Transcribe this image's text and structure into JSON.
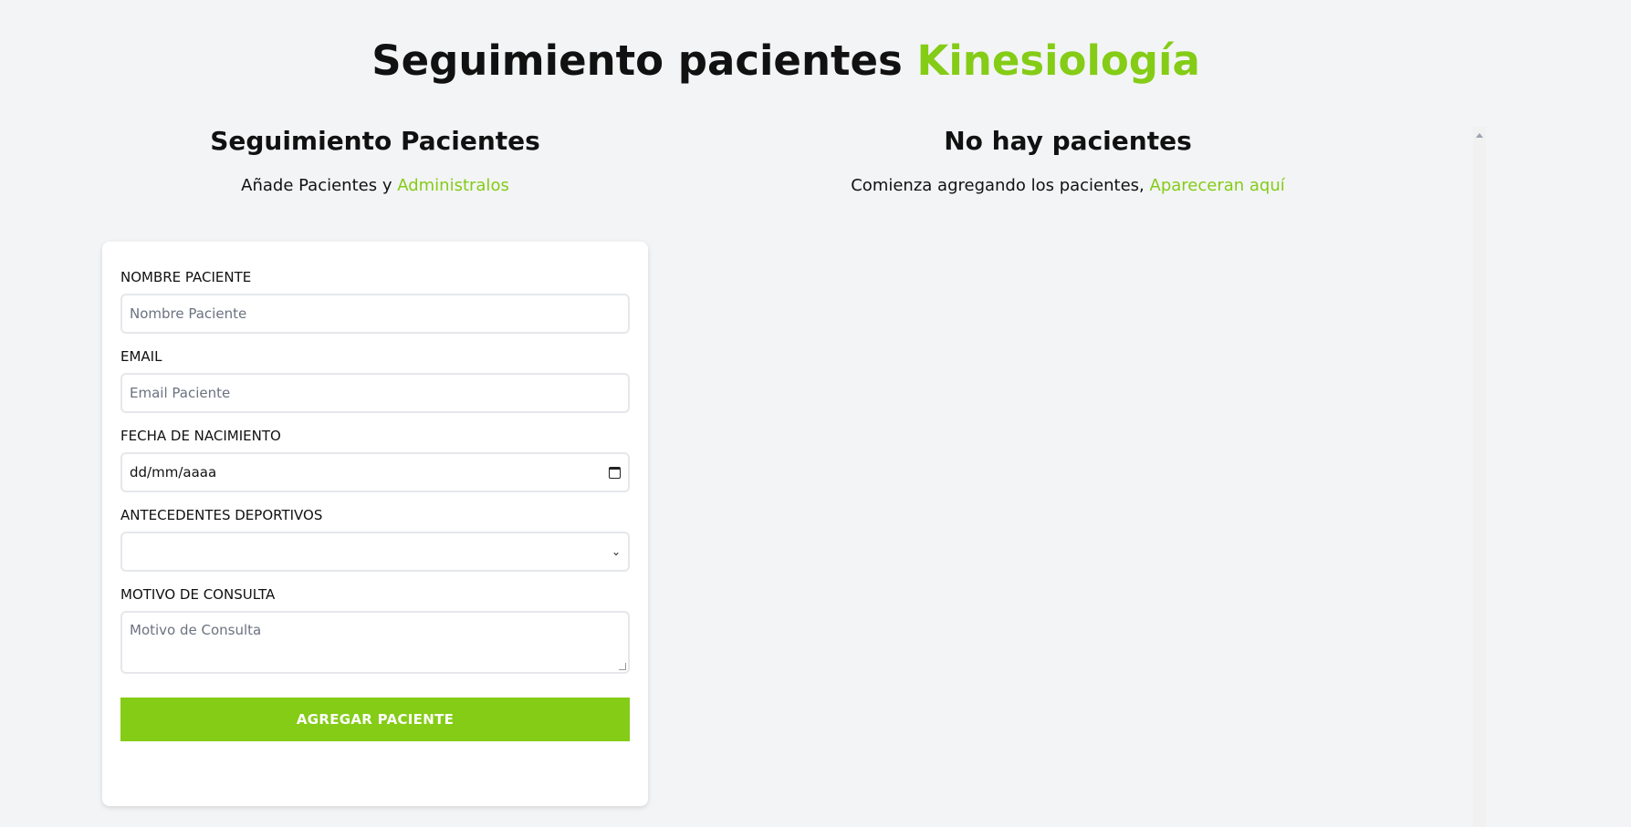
{
  "header": {
    "title_main": "Seguimiento pacientes ",
    "title_accent": "Kinesiología"
  },
  "form_section": {
    "title": "Seguimiento Pacientes",
    "subtitle_prefix": "Añade Pacientes y ",
    "subtitle_link": "Administralos"
  },
  "list_section": {
    "title": "No hay pacientes",
    "subtitle_prefix": "Comienza agregando los pacientes, ",
    "subtitle_link": "Apareceran aquí"
  },
  "form": {
    "nombre_label": "NOMBRE PACIENTE",
    "nombre_placeholder": "Nombre Paciente",
    "email_label": "EMAIL",
    "email_placeholder": "Email Paciente",
    "fecha_label": "FECHA DE NACIMIENTO",
    "fecha_value": "dd/mm/aaaa",
    "antecedentes_label": "ANTECEDENTES DEPORTIVOS",
    "antecedentes_value": "",
    "motivo_label": "MOTIVO DE CONSULTA",
    "motivo_placeholder": "Motivo de Consulta",
    "submit_label": "AGREGAR PACIENTE"
  },
  "icons": {
    "calendar": "calendar-icon",
    "select_chevron": "chevron-down-icon",
    "scroll_up": "arrow-up-icon"
  },
  "colors": {
    "accent": "#84cc16",
    "background": "#f3f4f6"
  }
}
